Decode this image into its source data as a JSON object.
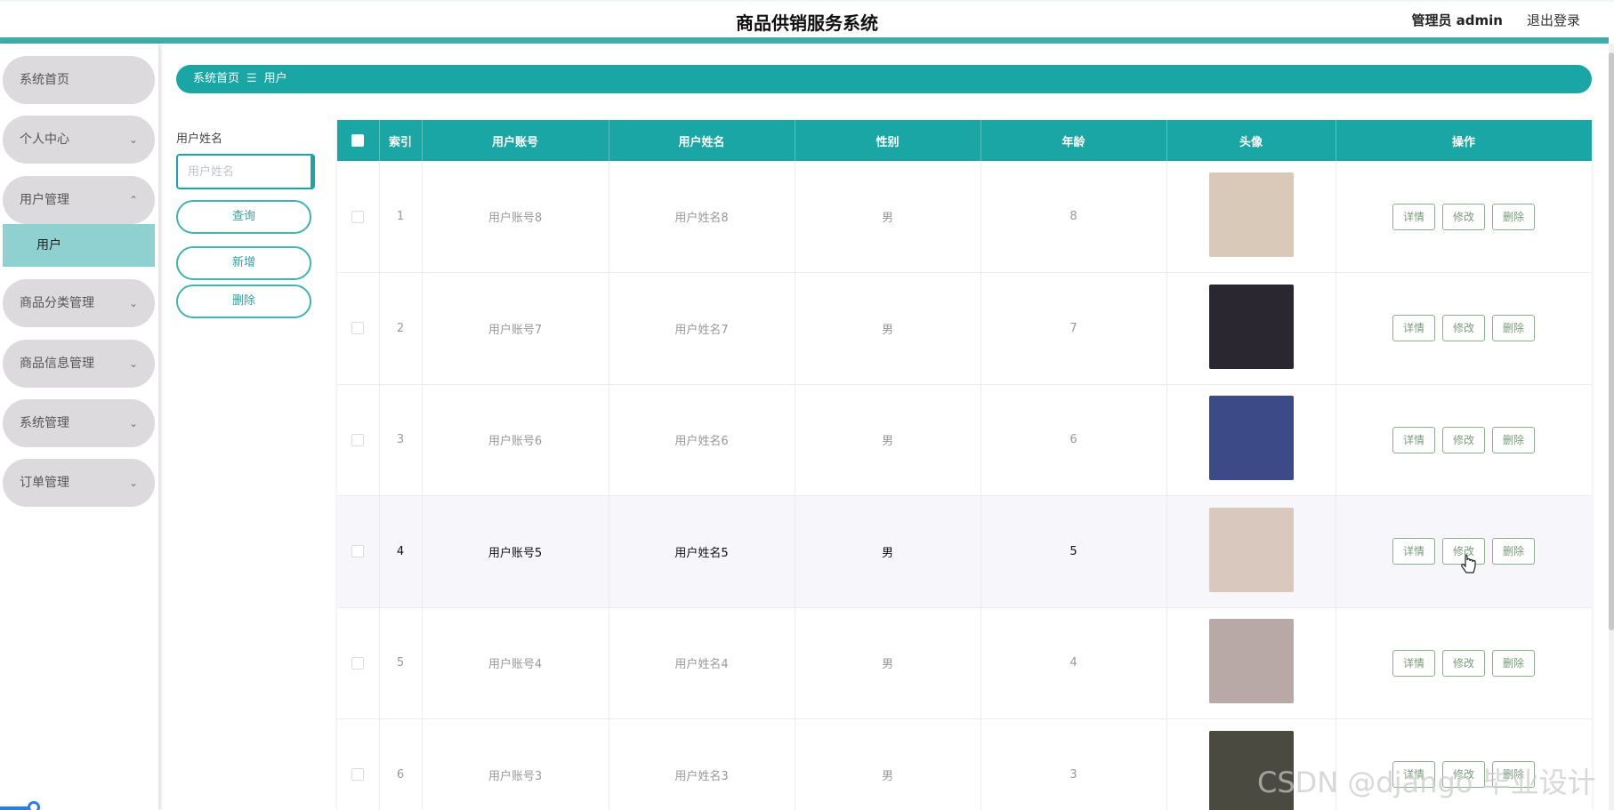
{
  "header": {
    "title": "商品供销服务系统",
    "admin": "管理员 admin",
    "logout": "退出登录"
  },
  "sidebar": {
    "items": [
      {
        "label": "系统首页",
        "chevron": ""
      },
      {
        "label": "个人中心",
        "chevron": "⌄"
      },
      {
        "label": "用户管理",
        "chevron": "⌃"
      },
      {
        "label": "商品分类管理",
        "chevron": "⌄"
      },
      {
        "label": "商品信息管理",
        "chevron": "⌄"
      },
      {
        "label": "系统管理",
        "chevron": "⌄"
      },
      {
        "label": "订单管理",
        "chevron": "⌄"
      }
    ],
    "submenu_label": "用户"
  },
  "breadcrumb": {
    "home": "系统首页",
    "separator": "☰",
    "current": "用户"
  },
  "search": {
    "label": "用户姓名",
    "placeholder": "用户姓名",
    "query_button": "查询",
    "add_button": "新增",
    "delete_button": "删除"
  },
  "table": {
    "headers": [
      "",
      "索引",
      "用户账号",
      "用户姓名",
      "性别",
      "年龄",
      "头像",
      "操作"
    ],
    "rows": [
      {
        "index": "1",
        "account": "用户账号8",
        "name": "用户姓名8",
        "gender": "男",
        "age": "8",
        "avatar_color": "#d8c9b8"
      },
      {
        "index": "2",
        "account": "用户账号7",
        "name": "用户姓名7",
        "gender": "男",
        "age": "7",
        "avatar_color": "#2a2730"
      },
      {
        "index": "3",
        "account": "用户账号6",
        "name": "用户姓名6",
        "gender": "男",
        "age": "6",
        "avatar_color": "#3c4a88"
      },
      {
        "index": "4",
        "account": "用户账号5",
        "name": "用户姓名5",
        "gender": "男",
        "age": "5",
        "avatar_color": "#d9c8bd"
      },
      {
        "index": "5",
        "account": "用户账号4",
        "name": "用户姓名4",
        "gender": "男",
        "age": "4",
        "avatar_color": "#b9a9a6"
      },
      {
        "index": "6",
        "account": "用户账号3",
        "name": "用户姓名3",
        "gender": "男",
        "age": "3",
        "avatar_color": "#4b4a40"
      }
    ],
    "actions": {
      "detail": "详情",
      "edit": "修改",
      "delete": "删除"
    },
    "active_row": 3
  },
  "watermark": "CSDN @django 毕业设计",
  "colors": {
    "primary": "#1aa6a5",
    "header_bar": "#3dacab",
    "submenu": "#8fd1d1"
  }
}
